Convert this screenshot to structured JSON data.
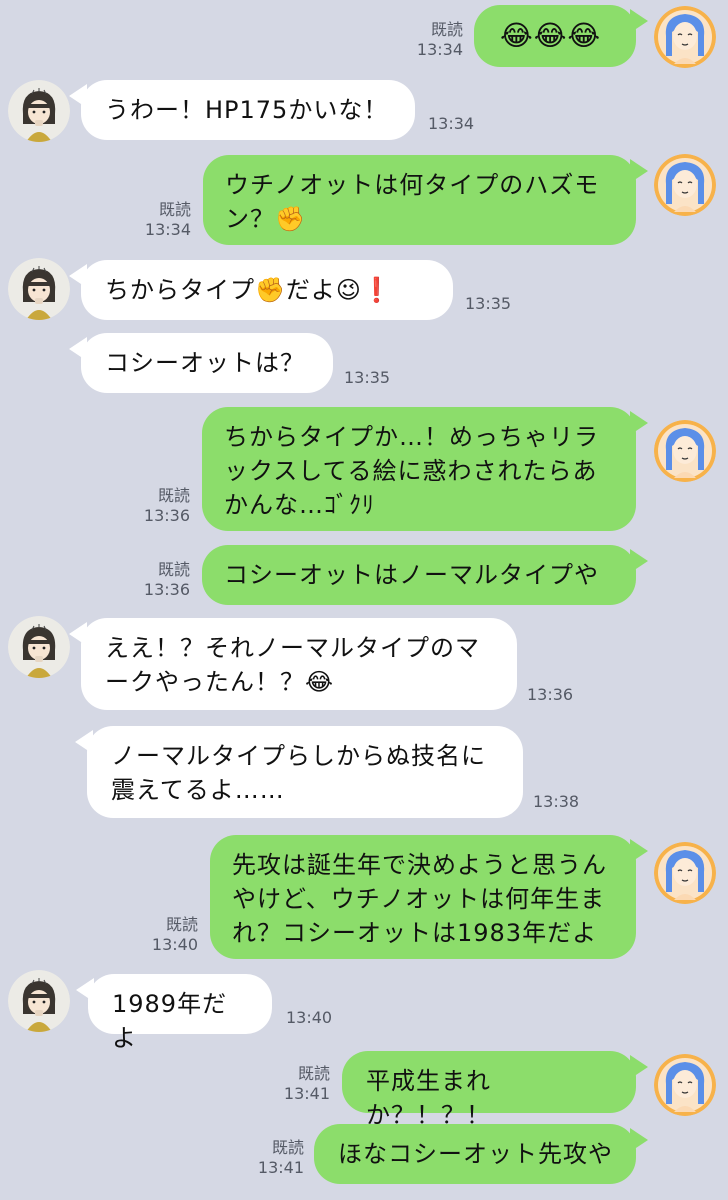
{
  "chat": {
    "read_label": "既読",
    "messages": [
      {
        "id": "m1",
        "side": "out",
        "text": "😂😂😂",
        "time": "13:34",
        "read": true
      },
      {
        "id": "m2",
        "side": "in",
        "text": "うわー！HP175かいな！",
        "time": "13:34"
      },
      {
        "id": "m3",
        "side": "out",
        "text": "ウチノオットは何タイプのハズモ\nン？✊",
        "time": "13:34",
        "read": true
      },
      {
        "id": "m4",
        "side": "in",
        "text": "ちからタイプ✊だよ😉❗",
        "time": "13:35"
      },
      {
        "id": "m5",
        "side": "in",
        "text": "コシーオットは？",
        "time": "13:35"
      },
      {
        "id": "m6",
        "side": "out",
        "text": "ちからタイプか…！めっちゃリラ\nックスしてる絵に惑わされたらあ\nかんな…ｺﾞｸﾘ",
        "time": "13:36",
        "read": true
      },
      {
        "id": "m7",
        "side": "out",
        "text": "コシーオットはノーマルタイプや",
        "time": "13:36",
        "read": true
      },
      {
        "id": "m8",
        "side": "in",
        "text": "ええ！？それノーマルタイプのマ\nークやったん！？😂",
        "time": "13:36"
      },
      {
        "id": "m9",
        "side": "in",
        "text": "ノーマルタイプらしからぬ技名に\n震えてるよ……",
        "time": "13:38"
      },
      {
        "id": "m10",
        "side": "out",
        "text": "先攻は誕生年で決めようと思うん\nやけど、ウチノオットは何年生ま\nれ？コシーオットは1983年だよ",
        "time": "13:40",
        "read": true
      },
      {
        "id": "m11",
        "side": "in",
        "text": "1989年だよ",
        "time": "13:40"
      },
      {
        "id": "m12",
        "side": "out",
        "text": "平成生まれか？！？！",
        "time": "13:41",
        "read": true
      },
      {
        "id": "m13",
        "side": "out",
        "text": "ほなコシーオット先攻や",
        "time": "13:41",
        "read": true
      }
    ]
  },
  "colors": {
    "background": "#d5d8e4",
    "bubble_out": "#8cdd6b",
    "bubble_in": "#ffffff",
    "meta_text": "#555a66"
  },
  "icons": {
    "avatar_out": "blue-haired-woman-avatar",
    "avatar_in": "dark-haired-woman-avatar"
  }
}
